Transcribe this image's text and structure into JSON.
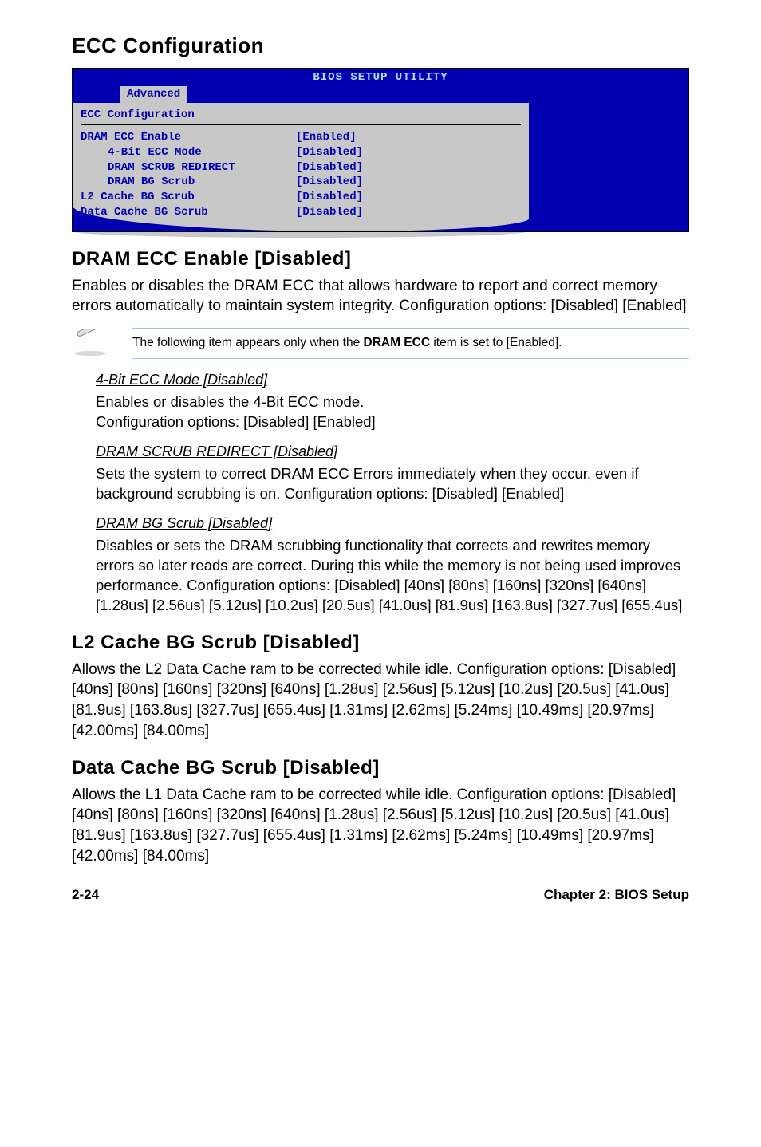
{
  "headings": {
    "ecc_config": "ECC Configuration",
    "dram_ecc_enable": "DRAM ECC Enable [Disabled]",
    "l2_cache": "L2 Cache BG Scrub [Disabled]",
    "data_cache": "Data Cache BG Scrub [Disabled]"
  },
  "bios": {
    "title": "BIOS SETUP UTILITY",
    "tab": "Advanced",
    "panel_title": "ECC Configuration",
    "rows": [
      {
        "label": "DRAM ECC Enable",
        "value": "[Enabled]",
        "indent": false
      },
      {
        "label": "4-Bit ECC Mode",
        "value": "[Disabled]",
        "indent": true
      },
      {
        "label": "DRAM SCRUB REDIRECT",
        "value": "[Disabled]",
        "indent": true
      },
      {
        "label": "DRAM BG Scrub",
        "value": "[Disabled]",
        "indent": true
      },
      {
        "label": "L2 Cache BG Scrub",
        "value": "[Disabled]",
        "indent": false
      },
      {
        "label": "Data Cache BG Scrub",
        "value": "[Disabled]",
        "indent": false
      }
    ]
  },
  "body": {
    "dram_ecc_enable_desc": "Enables or disables the DRAM ECC that allows hardware to report and correct memory errors automatically to maintain system integrity. Configuration options: [Disabled] [Enabled]",
    "note_prefix": "The following item appears only when the ",
    "note_bold": "DRAM ECC",
    "note_suffix": " item is set to [Enabled].",
    "l2_desc": "Allows the L2 Data Cache ram to be corrected while idle. Configuration options: [Disabled] [40ns] [80ns] [160ns] [320ns] [640ns] [1.28us] [2.56us] [5.12us] [10.2us] [20.5us] [41.0us] [81.9us] [163.8us] [327.7us] [655.4us] [1.31ms] [2.62ms] [5.24ms] [10.49ms] [20.97ms] [42.00ms] [84.00ms]",
    "data_desc": "Allows the L1 Data Cache ram to be corrected while idle. Configuration options: [Disabled] [40ns] [80ns] [160ns] [320ns] [640ns] [1.28us] [2.56us] [5.12us] [10.2us] [20.5us] [41.0us] [81.9us] [163.8us] [327.7us] [655.4us] [1.31ms] [2.62ms] [5.24ms] [10.49ms] [20.97ms] [42.00ms] [84.00ms]"
  },
  "sub": {
    "fourbit_head": "4-Bit ECC Mode [Disabled]",
    "fourbit_body": "Enables or disables the 4-Bit ECC mode.\nConfiguration options: [Disabled] [Enabled]",
    "scrubredir_head": "DRAM SCRUB REDIRECT [Disabled]",
    "scrubredir_body": "Sets the system to correct DRAM ECC Errors immediately when they occur, even if background scrubbing is on. Configuration options: [Disabled] [Enabled]",
    "bgscrub_head": "DRAM BG Scrub [Disabled]",
    "bgscrub_body": "Disables or sets the DRAM scrubbing functionality that corrects and rewrites memory errors so later reads are correct. During this while the memory is not being used improves performance. Configuration options: [Disabled] [40ns] [80ns] [160ns] [320ns] [640ns] [1.28us] [2.56us] [5.12us] [10.2us] [20.5us] [41.0us] [81.9us] [163.8us] [327.7us] [655.4us]"
  },
  "footer": {
    "left": "2-24",
    "right": "Chapter 2: BIOS Setup"
  }
}
